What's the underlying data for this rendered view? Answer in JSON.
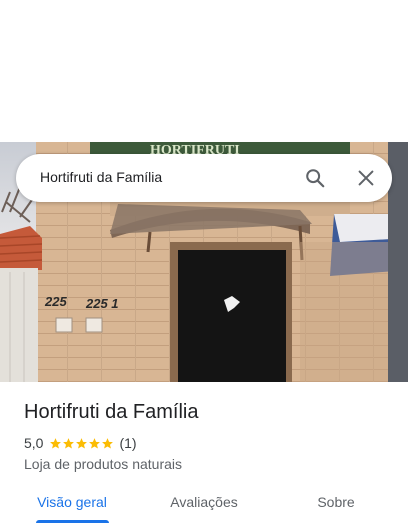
{
  "search": {
    "query": "Hortifruti da Família"
  },
  "place": {
    "name": "Hortifruti da Família",
    "rating": "5,0",
    "stars": 5,
    "review_count": "(1)",
    "category": "Loja de produtos naturais",
    "photo": {
      "house_numbers": [
        "225",
        "225 1"
      ],
      "storefront_sign": "HORTIFRUTI"
    }
  },
  "tabs": [
    {
      "label": "Visão geral",
      "active": true
    },
    {
      "label": "Avaliações",
      "active": false
    },
    {
      "label": "Sobre",
      "active": false
    }
  ],
  "colors": {
    "accent": "#1a73e8",
    "star": "#fbbc04",
    "text": "#202124",
    "muted": "#5f6368"
  }
}
